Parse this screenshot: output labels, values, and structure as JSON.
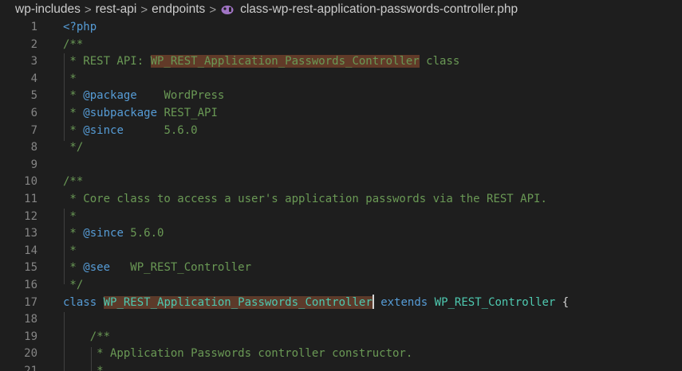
{
  "breadcrumb": {
    "items": [
      "wp-includes",
      "rest-api",
      "endpoints",
      "class-wp-rest-application-passwords-controller.php"
    ],
    "separator": ">"
  },
  "lines": [
    {
      "n": "1",
      "segs": [
        {
          "t": "<?php",
          "c": "tag"
        }
      ]
    },
    {
      "n": "2",
      "segs": [
        {
          "t": "/**",
          "c": "comment"
        }
      ]
    },
    {
      "n": "3",
      "segs": [
        {
          "t": " * REST API: ",
          "c": "comment"
        },
        {
          "t": "WP_REST_Application_Passwords_Controller",
          "c": "comment hl"
        },
        {
          "t": " class",
          "c": "comment"
        }
      ]
    },
    {
      "n": "4",
      "segs": [
        {
          "t": " *",
          "c": "comment"
        }
      ]
    },
    {
      "n": "5",
      "segs": [
        {
          "t": " * ",
          "c": "comment"
        },
        {
          "t": "@package",
          "c": "doctag"
        },
        {
          "t": "    WordPress",
          "c": "comment"
        }
      ]
    },
    {
      "n": "6",
      "segs": [
        {
          "t": " * ",
          "c": "comment"
        },
        {
          "t": "@subpackage",
          "c": "doctag"
        },
        {
          "t": " REST_API",
          "c": "comment"
        }
      ]
    },
    {
      "n": "7",
      "segs": [
        {
          "t": " * ",
          "c": "comment"
        },
        {
          "t": "@since",
          "c": "doctag"
        },
        {
          "t": "      5.6.0",
          "c": "comment"
        }
      ]
    },
    {
      "n": "8",
      "segs": [
        {
          "t": " */",
          "c": "comment"
        }
      ]
    },
    {
      "n": "9",
      "segs": []
    },
    {
      "n": "10",
      "segs": [
        {
          "t": "/**",
          "c": "comment"
        }
      ]
    },
    {
      "n": "11",
      "segs": [
        {
          "t": " * Core class to access a user's application passwords via the REST API.",
          "c": "comment"
        }
      ]
    },
    {
      "n": "12",
      "segs": [
        {
          "t": " *",
          "c": "comment"
        }
      ]
    },
    {
      "n": "13",
      "segs": [
        {
          "t": " * ",
          "c": "comment"
        },
        {
          "t": "@since",
          "c": "doctag"
        },
        {
          "t": " 5.6.0",
          "c": "comment"
        }
      ]
    },
    {
      "n": "14",
      "segs": [
        {
          "t": " *",
          "c": "comment"
        }
      ]
    },
    {
      "n": "15",
      "segs": [
        {
          "t": " * ",
          "c": "comment"
        },
        {
          "t": "@see",
          "c": "doctag"
        },
        {
          "t": "   WP_REST_Controller",
          "c": "comment"
        }
      ]
    },
    {
      "n": "16",
      "segs": [
        {
          "t": " */",
          "c": "comment"
        }
      ]
    },
    {
      "n": "17",
      "segs": [
        {
          "t": "class",
          "c": "kw"
        },
        {
          "t": " ",
          "c": "plain"
        },
        {
          "t": "WP_REST_Application_Passwords_Controller",
          "c": "cls hl-sel"
        },
        {
          "t": "",
          "c": "cursor"
        },
        {
          "t": " ",
          "c": "plain"
        },
        {
          "t": "extends",
          "c": "kw"
        },
        {
          "t": " ",
          "c": "plain"
        },
        {
          "t": "WP_REST_Controller",
          "c": "cls"
        },
        {
          "t": " {",
          "c": "plain"
        }
      ]
    },
    {
      "n": "18",
      "segs": []
    },
    {
      "n": "19",
      "segs": [
        {
          "t": "    /**",
          "c": "comment"
        }
      ]
    },
    {
      "n": "20",
      "segs": [
        {
          "t": "     * Application Passwords controller constructor.",
          "c": "comment"
        }
      ]
    },
    {
      "n": "21",
      "segs": [
        {
          "t": "     *",
          "c": "comment"
        }
      ]
    }
  ]
}
